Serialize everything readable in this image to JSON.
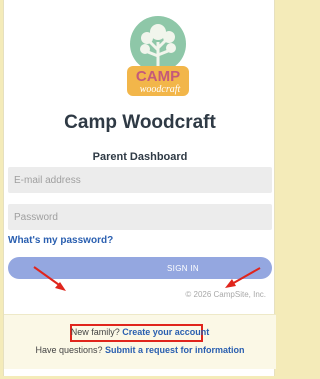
{
  "brand": {
    "name": "Camp Woodcraft",
    "logo_text_top": "CAMP",
    "logo_text_bottom": "woodcraft",
    "colors": {
      "logo_circle": "#8ec7a8",
      "logo_banner": "#f2b64a"
    }
  },
  "login": {
    "subtitle": "Parent Dashboard",
    "email_placeholder": "E-mail address",
    "password_placeholder": "Password",
    "forgot_link": "What's my password?",
    "signin_label": "SIGN IN",
    "copyright": "© 2026 CampSite, Inc."
  },
  "footer": {
    "new_family_text": "New family?",
    "create_account_link": "Create your account",
    "questions_text": "Have questions?",
    "request_link": "Submit a request for information"
  },
  "annotations": {
    "color": "#e0251c"
  }
}
